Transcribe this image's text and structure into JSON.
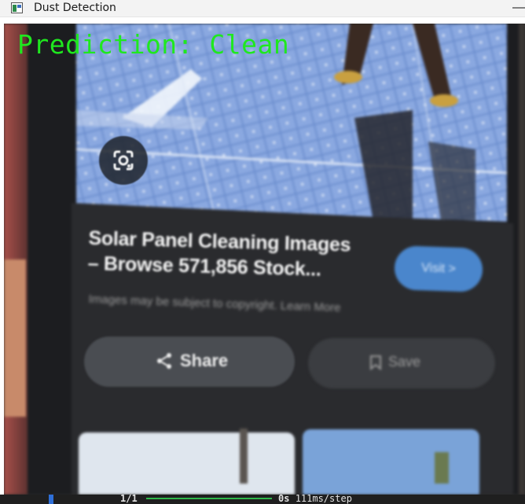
{
  "window": {
    "title": "Dust Detection",
    "minimize_glyph": "—"
  },
  "overlay": {
    "prediction": "Prediction: Clean",
    "color": "#1fe81f"
  },
  "phone_screen": {
    "lens_icon": "google-lens-icon",
    "card_title_line1": "Solar Panel Cleaning Images",
    "card_title_line2": "– Browse 571,856 Stock...",
    "visit_label": "Visit >",
    "copyright_text": "Images may be subject to copyright. Learn More",
    "share_label": "Share",
    "share_icon": "share-icon",
    "save_label": "Save",
    "save_icon": "bookmark-icon"
  },
  "progress": {
    "count": "1/1",
    "fraction": 1.0,
    "elapsed": "0s",
    "rate": "111ms/step",
    "bar_color": "#2fb84a"
  }
}
